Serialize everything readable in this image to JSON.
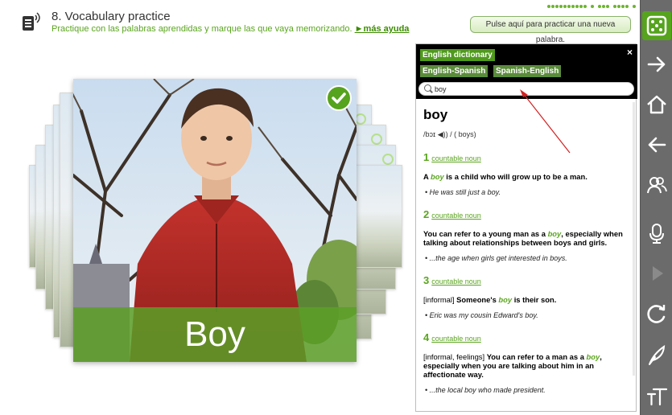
{
  "header": {
    "title": "8. Vocabulary practice",
    "subtitle": "Practique con las palabras aprendidas y marque las que vaya memorizando. ",
    "more_help": "►más ayuda",
    "practice_button": "Pulse aquí para practicar una nueva palabra."
  },
  "card": {
    "caption": "Boy",
    "learned": true
  },
  "dictionary": {
    "title": "English dictionary",
    "close_label": "×",
    "tabs": [
      "English-Spanish",
      "Spanish-English"
    ],
    "search_value": "boy",
    "headword": "boy",
    "pronunciation": "/bɔɪ ◀)) / ( boys)",
    "senses": [
      {
        "number": "1",
        "pos": "countable noun",
        "label": "",
        "def_before": "A ",
        "keyword": "boy",
        "def_after": " is a child who will grow up to be a man.",
        "example": "• He was still just a boy."
      },
      {
        "number": "2",
        "pos": "countable noun",
        "label": "",
        "def_before": "You can refer to a young man as a ",
        "keyword": "boy",
        "def_after": ", especially when talking about relationships between boys and girls.",
        "example": "• ...the age when girls get interested in boys."
      },
      {
        "number": "3",
        "pos": "countable noun",
        "label": "[informal] ",
        "def_before": "Someone's ",
        "keyword": "boy",
        "def_after": " is their son.",
        "example": "• Eric was my cousin Edward's boy."
      },
      {
        "number": "4",
        "pos": "countable noun",
        "label": "[informal, feelings] ",
        "def_before": "You can refer to a man as a ",
        "keyword": "boy",
        "def_after": ", especially when you are talking about him in an affectionate way.",
        "example": "• ...the local boy who made president."
      }
    ]
  },
  "toolbar": {
    "icons": [
      "dice-icon",
      "next-arrow-icon",
      "home-icon",
      "back-arrow-icon",
      "users-icon",
      "microphone-icon",
      "play-icon",
      "refresh-icon",
      "feather-icon",
      "text-size-icon"
    ]
  },
  "colors": {
    "accent_green": "#56a31e",
    "toolbar_gray": "#6b6b6b"
  }
}
